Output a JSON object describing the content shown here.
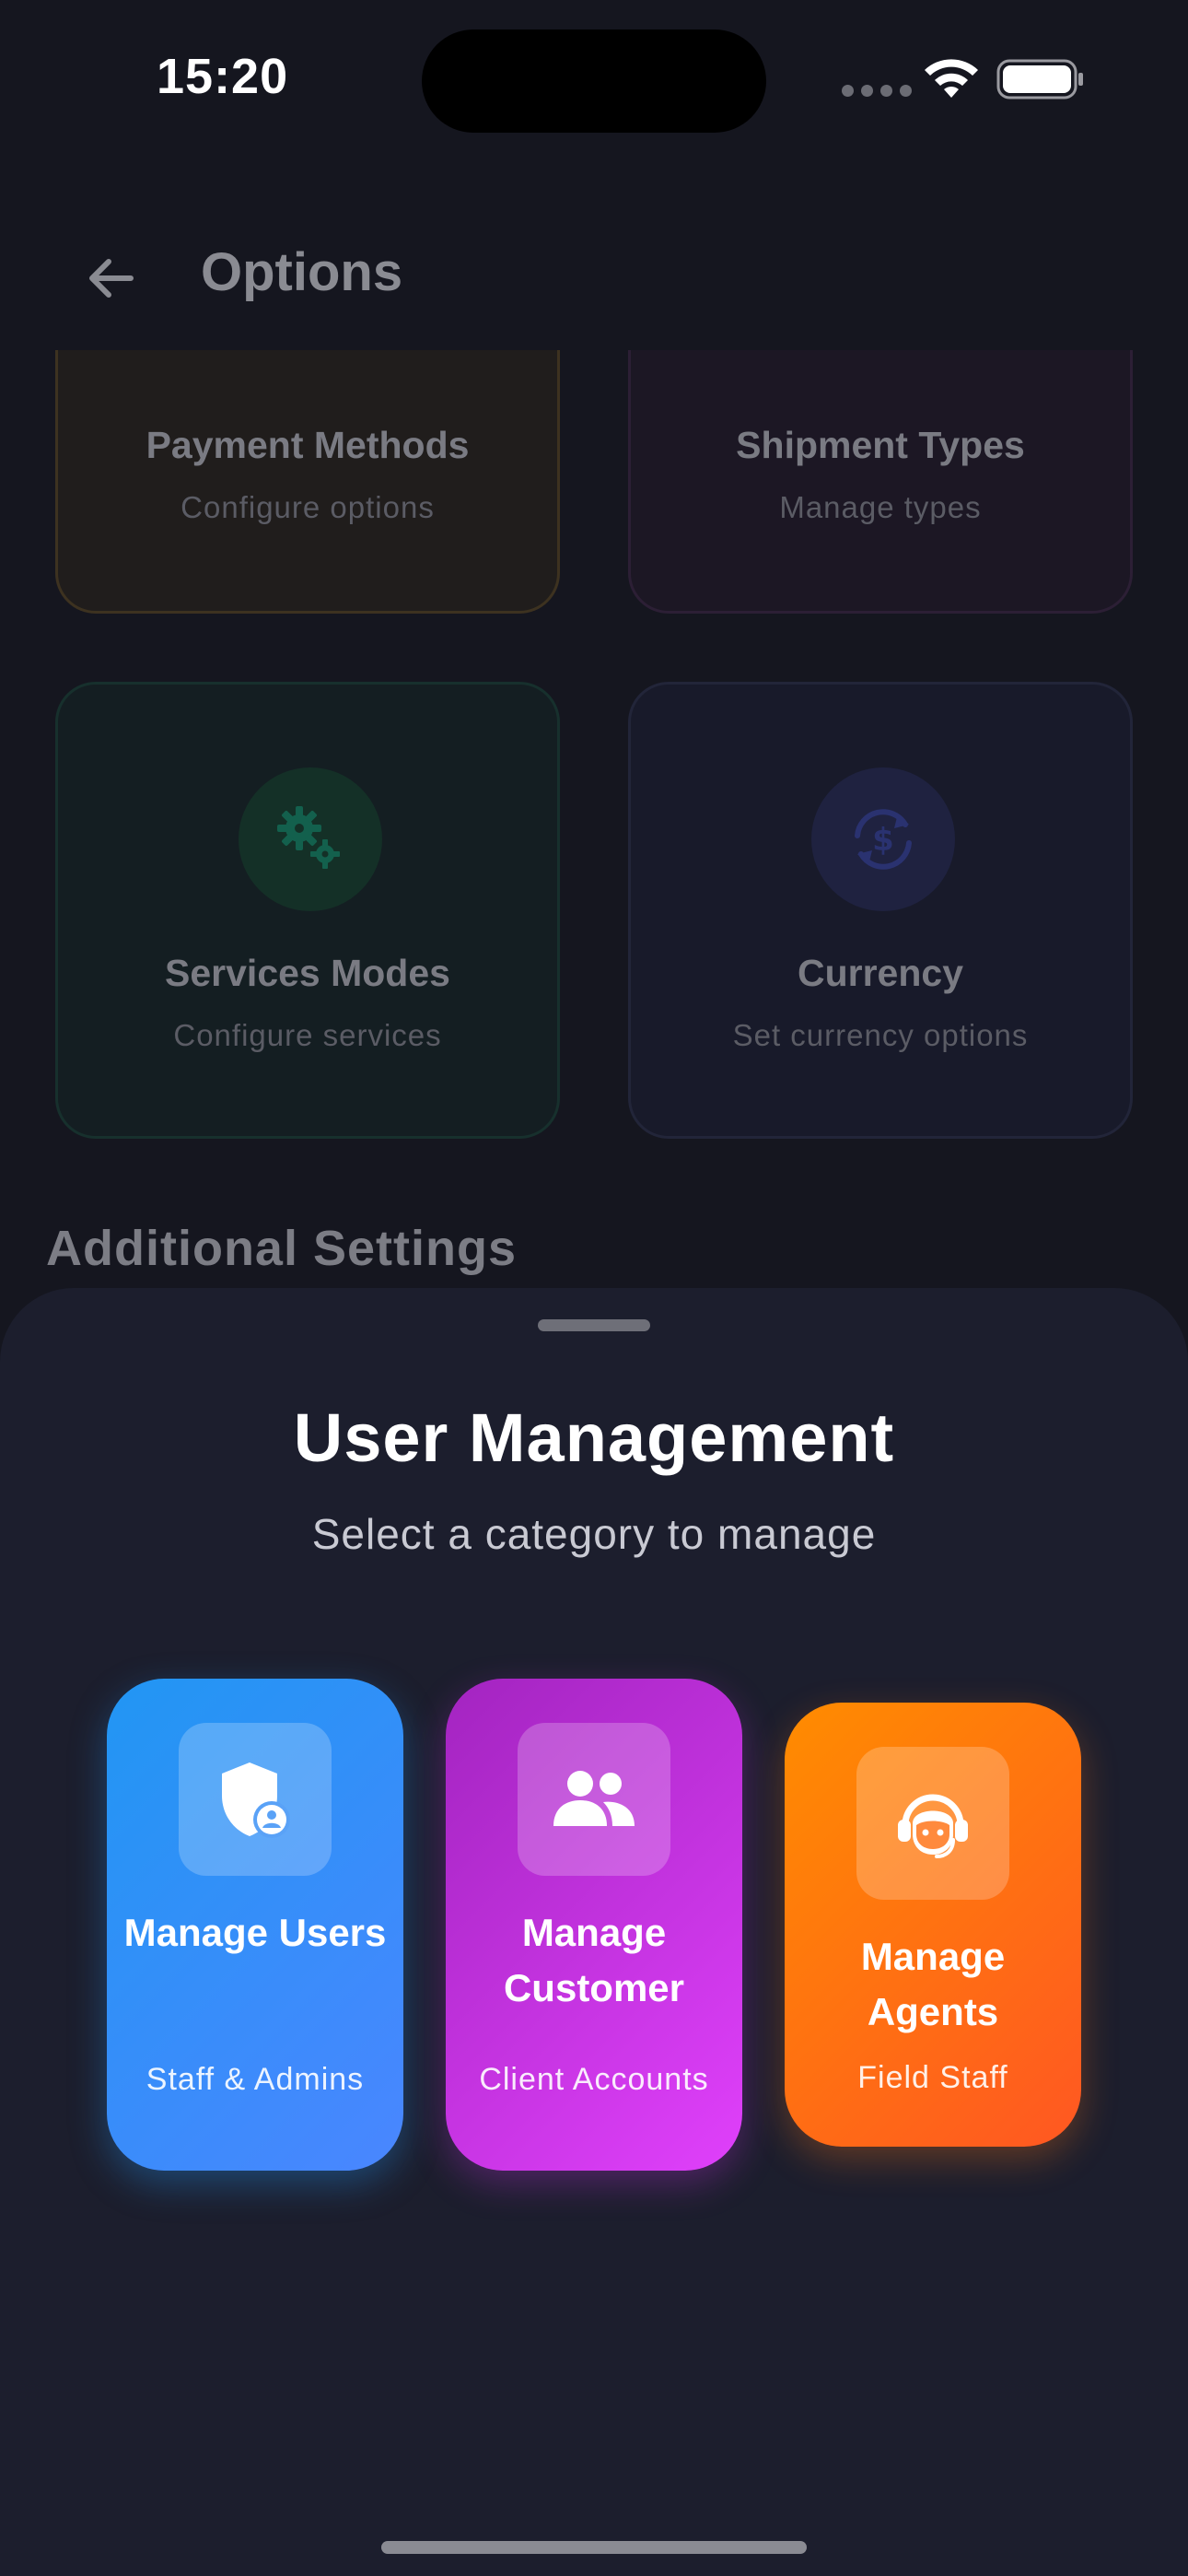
{
  "status_bar": {
    "time": "15:20"
  },
  "header": {
    "title": "Options",
    "back_icon": "arrow-left-icon"
  },
  "option_cards": [
    {
      "title": "Payment Methods",
      "subtitle": "Configure options",
      "accent": "#5a4420"
    },
    {
      "title": "Shipment Types",
      "subtitle": "Manage types",
      "accent": "#3a2246"
    },
    {
      "title": "Services Modes",
      "subtitle": "Configure services",
      "icon": "gears-icon",
      "accent": "#12453b"
    },
    {
      "title": "Currency",
      "subtitle": "Set currency options",
      "icon": "currency-exchange-icon",
      "accent": "#252a4e"
    }
  ],
  "section_heading": "Additional Settings",
  "sheet": {
    "title": "User Management",
    "subtitle": "Select a category to manage",
    "categories": [
      {
        "title": "Manage Users",
        "subtitle": "Staff & Admins",
        "icon": "shield-user-icon",
        "color_start": "#2196f3",
        "color_end": "#4a86ff"
      },
      {
        "title": "Manage Customer",
        "subtitle": "Client Accounts",
        "icon": "people-icon",
        "color_start": "#a324c0",
        "color_end": "#e040fb"
      },
      {
        "title": "Manage Agents",
        "subtitle": "Field Staff",
        "icon": "support-agent-icon",
        "color_start": "#ff8c00",
        "color_end": "#ff5722"
      }
    ]
  }
}
